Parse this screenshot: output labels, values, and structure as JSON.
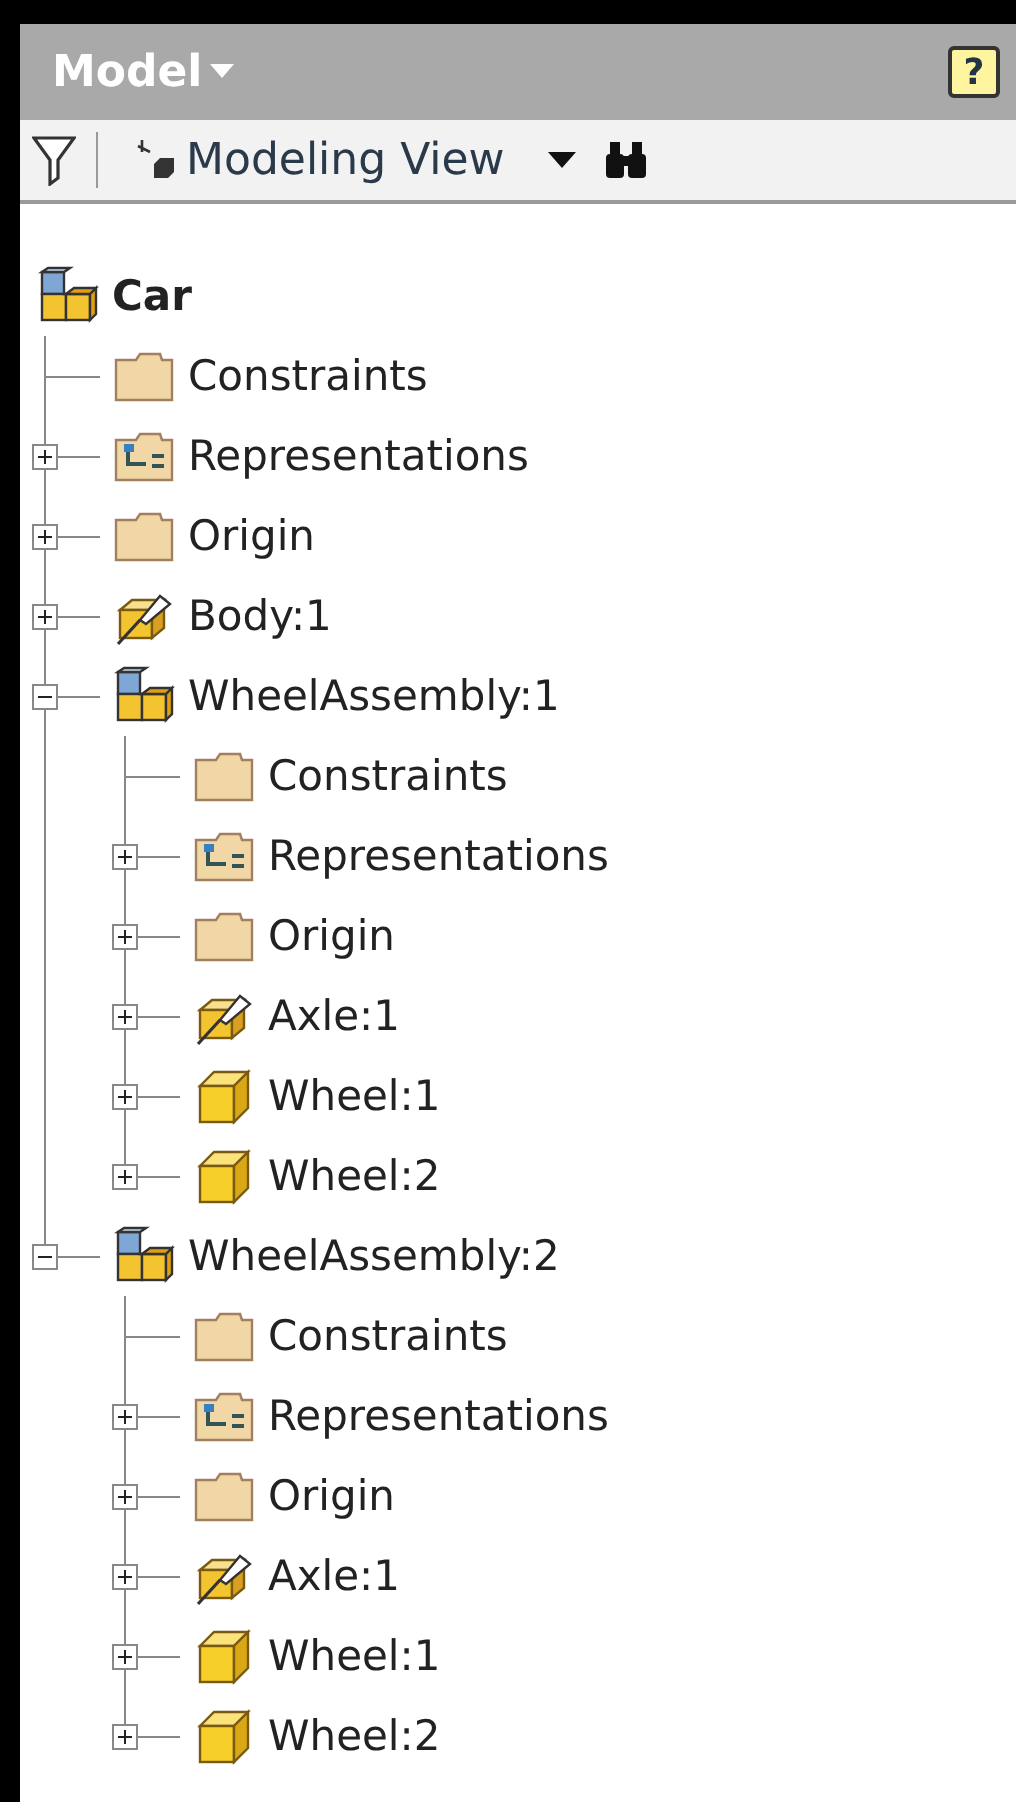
{
  "header": {
    "title": "Model",
    "help_button": "?"
  },
  "toolbar": {
    "view": "Modeling View"
  },
  "tree": [
    {
      "label": "Car",
      "kind": "assembly",
      "children": [
        {
          "label": "Constraints",
          "kind": "folder"
        },
        {
          "label": "Representations",
          "kind": "representations",
          "expanded": false
        },
        {
          "label": "Origin",
          "kind": "folder",
          "expanded": false
        },
        {
          "label": "Body:1",
          "kind": "pinned-part",
          "expanded": false
        },
        {
          "label": "WheelAssembly:1",
          "kind": "assembly",
          "expanded": true,
          "children": [
            {
              "label": "Constraints",
              "kind": "folder"
            },
            {
              "label": "Representations",
              "kind": "representations",
              "expanded": false
            },
            {
              "label": "Origin",
              "kind": "folder",
              "expanded": false
            },
            {
              "label": "Axle:1",
              "kind": "pinned-part",
              "expanded": false
            },
            {
              "label": "Wheel:1",
              "kind": "part",
              "expanded": false
            },
            {
              "label": "Wheel:2",
              "kind": "part",
              "expanded": false
            }
          ]
        },
        {
          "label": "WheelAssembly:2",
          "kind": "assembly",
          "expanded": true,
          "children": [
            {
              "label": "Constraints",
              "kind": "folder"
            },
            {
              "label": "Representations",
              "kind": "representations",
              "expanded": false
            },
            {
              "label": "Origin",
              "kind": "folder",
              "expanded": false
            },
            {
              "label": "Axle:1",
              "kind": "pinned-part",
              "expanded": false
            },
            {
              "label": "Wheel:1",
              "kind": "part",
              "expanded": false
            },
            {
              "label": "Wheel:2",
              "kind": "part",
              "expanded": false
            }
          ]
        }
      ]
    }
  ]
}
